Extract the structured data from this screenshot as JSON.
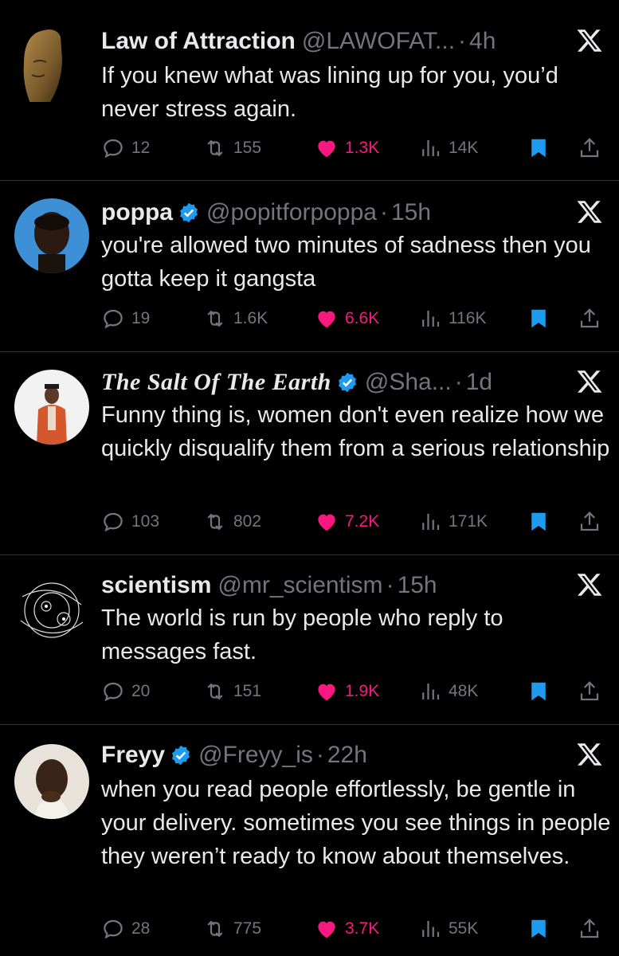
{
  "colors": {
    "background": "#000000",
    "text": "#e7e9ea",
    "muted": "#71767b",
    "like": "#f91880",
    "bookmark": "#1d9bf0",
    "verified": "#1d9bf0"
  },
  "tweets": [
    {
      "name": "Law of Attraction",
      "verified": false,
      "handle": "@LAWOFAT...",
      "time": "4h",
      "text": "If you knew what was lining up for you, you’d never stress again.",
      "replies": "12",
      "reposts": "155",
      "likes": "1.3K",
      "views": "14K",
      "avatar": "buddha-face"
    },
    {
      "name": "poppa",
      "verified": true,
      "handle": "@popitforpoppa",
      "time": "15h",
      "text": "you're allowed two minutes of sadness then you gotta keep it gangsta",
      "replies": "19",
      "reposts": "1.6K",
      "likes": "6.6K",
      "views": "116K",
      "avatar": "man-blue-background"
    },
    {
      "name": "The Salt Of The Earth",
      "verified": true,
      "handle": "@Sha...",
      "time": "1d",
      "text": "Funny thing is, women don't even realize how we quickly disqualify them from a serious relationship",
      "replies": "103",
      "reposts": "802",
      "likes": "7.2K",
      "views": "171K",
      "avatar": "man-orange-suit"
    },
    {
      "name": "scientism",
      "verified": false,
      "handle": "@mr_scientism",
      "time": "15h",
      "text": "The world is run by people who reply to messages fast.",
      "replies": "20",
      "reposts": "151",
      "likes": "1.9K",
      "views": "48K",
      "avatar": "orbit-sketch"
    },
    {
      "name": "Freyy",
      "verified": true,
      "handle": "@Freyy_is",
      "time": "22h",
      "text": "when you read people effortlessly, be gentle in your delivery. sometimes you see things in people they weren’t ready to know about themselves.",
      "replies": "28",
      "reposts": "775",
      "likes": "3.7K",
      "views": "55K",
      "avatar": "man-hand-on-chin"
    }
  ],
  "dot": "·"
}
